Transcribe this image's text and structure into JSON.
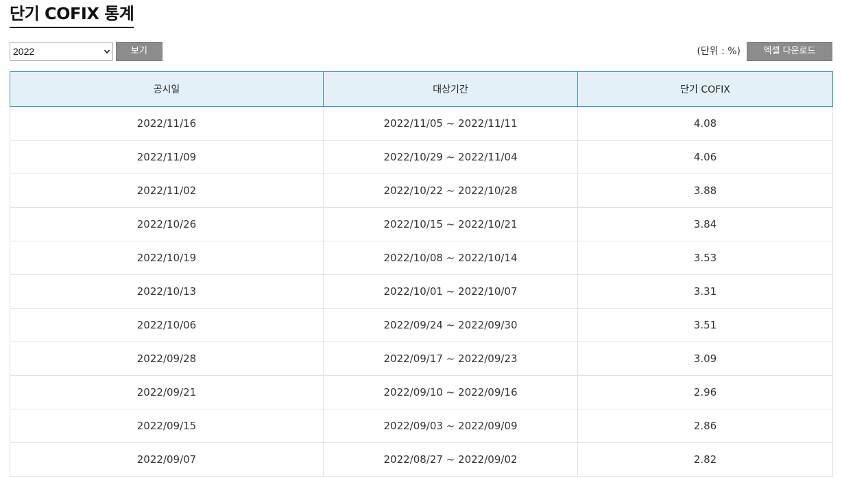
{
  "page": {
    "title": "단기 COFIX 통계"
  },
  "toolbar": {
    "year_value": "2022",
    "view_label": "보기",
    "unit_label": "(단위 : %)",
    "excel_label": "엑셀 다운로드"
  },
  "table": {
    "headers": [
      "공시일",
      "대상기간",
      "단기 COFIX"
    ],
    "rows": [
      {
        "date": "2022/11/16",
        "period": "2022/11/05 ~ 2022/11/11",
        "rate": "4.08"
      },
      {
        "date": "2022/11/09",
        "period": "2022/10/29 ~ 2022/11/04",
        "rate": "4.06"
      },
      {
        "date": "2022/11/02",
        "period": "2022/10/22 ~ 2022/10/28",
        "rate": "3.88"
      },
      {
        "date": "2022/10/26",
        "period": "2022/10/15 ~ 2022/10/21",
        "rate": "3.84"
      },
      {
        "date": "2022/10/19",
        "period": "2022/10/08 ~ 2022/10/14",
        "rate": "3.53"
      },
      {
        "date": "2022/10/13",
        "period": "2022/10/01 ~ 2022/10/07",
        "rate": "3.31"
      },
      {
        "date": "2022/10/06",
        "period": "2022/09/24 ~ 2022/09/30",
        "rate": "3.51"
      },
      {
        "date": "2022/09/28",
        "period": "2022/09/17 ~ 2022/09/23",
        "rate": "3.09"
      },
      {
        "date": "2022/09/21",
        "period": "2022/09/10 ~ 2022/09/16",
        "rate": "2.96"
      },
      {
        "date": "2022/09/15",
        "period": "2022/09/03 ~ 2022/09/09",
        "rate": "2.86"
      },
      {
        "date": "2022/09/07",
        "period": "2022/08/27 ~ 2022/09/02",
        "rate": "2.82"
      }
    ]
  },
  "colors": {
    "header_bg": "#e3f0f7",
    "header_border": "#3d8fb0",
    "button_bg": "#8c8c8c"
  }
}
